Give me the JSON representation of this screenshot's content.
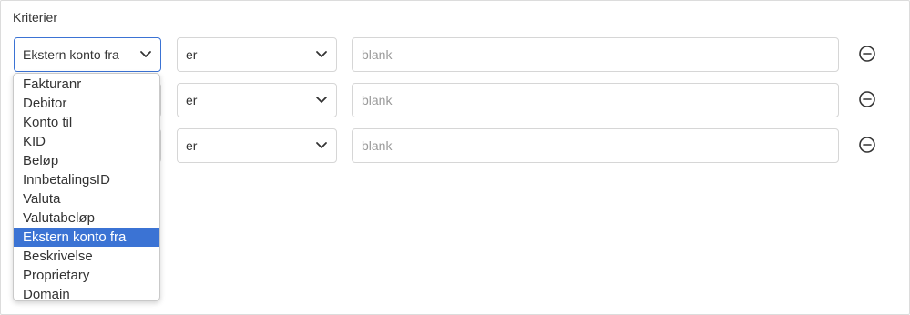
{
  "section": {
    "title": "Kriterier"
  },
  "rows": [
    {
      "field": "Ekstern konto fra",
      "operator": "er",
      "value_placeholder": "blank"
    },
    {
      "field": "",
      "operator": "er",
      "value_placeholder": "blank"
    },
    {
      "field": "",
      "operator": "er",
      "value_placeholder": "blank"
    }
  ],
  "field_options": [
    "Fakturanr",
    "Debitor",
    "Konto til",
    "KID",
    "Beløp",
    "InnbetalingsID",
    "Valuta",
    "Valutabeløp",
    "Ekstern konto fra",
    "Beskrivelse",
    "Proprietary",
    "Domain"
  ],
  "selected_option": "Ekstern konto fra",
  "icons": {
    "chevron": "chevron-down-icon",
    "remove": "minus-circle-icon"
  },
  "colors": {
    "accent": "#3b73d4",
    "border": "#d6d6d6",
    "placeholder": "#9a9a9a"
  }
}
